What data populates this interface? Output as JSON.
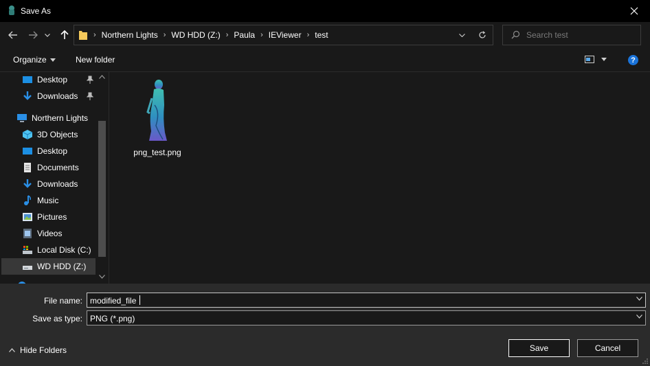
{
  "window": {
    "title": "Save As"
  },
  "address": {
    "crumbs": [
      "Northern Lights",
      "WD HDD (Z:)",
      "Paula",
      "IEViewer",
      "test"
    ]
  },
  "search": {
    "placeholder": "Search test"
  },
  "toolbar": {
    "organize_label": "Organize",
    "new_folder_label": "New folder"
  },
  "nav": {
    "quick_access": [
      {
        "label": "Desktop",
        "icon": "desktop-icon",
        "pinned": true
      },
      {
        "label": "Downloads",
        "icon": "downloads-icon",
        "pinned": true
      }
    ],
    "this_pc": {
      "label": "Northern Lights",
      "icon": "computer-icon"
    },
    "items": [
      {
        "label": "3D Objects",
        "icon": "3d-objects-icon"
      },
      {
        "label": "Desktop",
        "icon": "desktop-icon"
      },
      {
        "label": "Documents",
        "icon": "documents-icon"
      },
      {
        "label": "Downloads",
        "icon": "downloads-icon"
      },
      {
        "label": "Music",
        "icon": "music-icon"
      },
      {
        "label": "Pictures",
        "icon": "pictures-icon"
      },
      {
        "label": "Videos",
        "icon": "videos-icon"
      },
      {
        "label": "Local Disk (C:)",
        "icon": "local-disk-icon"
      },
      {
        "label": "WD HDD (Z:)",
        "icon": "drive-icon",
        "selected": true
      }
    ]
  },
  "files": [
    {
      "name": "png_test.png",
      "icon": "image-thumbnail"
    }
  ],
  "form": {
    "file_name_label": "File name:",
    "file_name_value": "modified_file",
    "save_type_label": "Save as type:",
    "save_type_value": "PNG (*.png)"
  },
  "footer": {
    "hide_folders_label": "Hide Folders",
    "save_label": "Save",
    "cancel_label": "Cancel"
  },
  "colors": {
    "accent": "#1a73d9",
    "folder": "#f5c95a",
    "background": "#191919",
    "panel": "#2b2b2b"
  }
}
